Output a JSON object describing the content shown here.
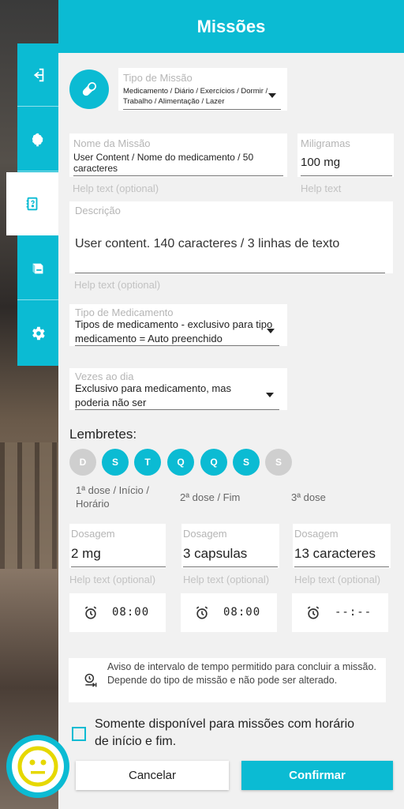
{
  "header": {
    "title": "Missões"
  },
  "colors": {
    "accent": "#0bbbd3",
    "panel": "#f1f1f1",
    "inactive_day": "#cfcfcf",
    "avatar_face": "#e6d800"
  },
  "sidenav": {
    "items": [
      {
        "icon": "exit-icon",
        "active": false
      },
      {
        "icon": "brain-icon",
        "active": false
      },
      {
        "icon": "mission-book-icon",
        "active": true
      },
      {
        "icon": "stack-book-icon",
        "active": false
      },
      {
        "icon": "gear-icon",
        "active": false
      }
    ]
  },
  "form": {
    "tipo_missao": {
      "label": "Tipo de Missão",
      "value": "Medicamento / Diário / Exercícios / Dormir / Trabalho / Alimentação / Lazer",
      "icon": "pill-icon"
    },
    "nome_missao": {
      "label": "Nome da Missão",
      "value": "User Content / Nome do medicamento / 50 caracteres",
      "help": "Help text (optional)"
    },
    "miligramas": {
      "label": "Miligramas",
      "value": "100 mg",
      "help": "Help text"
    },
    "descricao": {
      "label": "Descrição",
      "value": "User content. 140 caracteres / 3 linhas de texto",
      "help": "Help text (optional)"
    },
    "tipo_medicamento": {
      "label": "Tipo de Medicamento",
      "value": "Tipos de medicamento - exclusivo para tipo medicamento = Auto preenchido"
    },
    "vezes_dia": {
      "label": "Vezes ao dia",
      "value": "Exclusivo para medicamento, mas poderia não ser"
    }
  },
  "lembretes": {
    "label": "Lembretes:",
    "days": [
      {
        "letter": "D",
        "active": false
      },
      {
        "letter": "S",
        "active": true
      },
      {
        "letter": "T",
        "active": true
      },
      {
        "letter": "Q",
        "active": true
      },
      {
        "letter": "Q",
        "active": true
      },
      {
        "letter": "S",
        "active": true
      },
      {
        "letter": "S",
        "active": false
      }
    ]
  },
  "doses": [
    {
      "title": "1ª dose / Início / Horário",
      "dosagem_label": "Dosagem",
      "dosagem_value": "2 mg",
      "help": "Help text (optional)",
      "time": "08:00"
    },
    {
      "title": "2ª dose / Fim",
      "dosagem_label": "Dosagem",
      "dosagem_value": "3 capsulas",
      "help": "Help text (optional)",
      "time": "08:00"
    },
    {
      "title": "3ª dose",
      "dosagem_label": "Dosagem",
      "dosagem_value": "13 caracteres",
      "help": "Help text (optional)",
      "time": "--:--"
    }
  ],
  "notice": {
    "text": "Aviso de intervalo de tempo permitido para concluir a missão. Depende do tipo de missão e não pode ser alterado.",
    "icon": "clock-interval-icon"
  },
  "checkbox": {
    "label": "Somente disponível para missões com horário de início e fim.",
    "checked": false
  },
  "buttons": {
    "cancel": "Cancelar",
    "confirm": "Confirmar"
  },
  "avatar": {
    "icon": "neutral-face-icon"
  }
}
